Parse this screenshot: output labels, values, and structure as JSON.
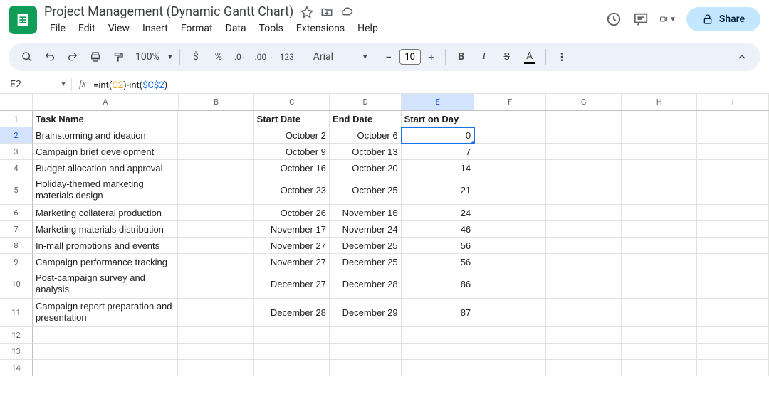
{
  "doc": {
    "title": "Project Management (Dynamic Gantt Chart)"
  },
  "menu": {
    "file": "File",
    "edit": "Edit",
    "view": "View",
    "insert": "Insert",
    "format": "Format",
    "data": "Data",
    "tools": "Tools",
    "extensions": "Extensions",
    "help": "Help"
  },
  "share": {
    "label": "Share"
  },
  "toolbar": {
    "zoom": "100%",
    "font": "Arial",
    "font_size": "10",
    "currency": "$",
    "percent": "%",
    "n123": "123"
  },
  "namebox": "E2",
  "formula": {
    "p1": "=int(",
    "ref1": "C2",
    "p2": ")-int(",
    "ref2": "$C$2",
    "p3": ")"
  },
  "columns": [
    "A",
    "B",
    "C",
    "D",
    "E",
    "F",
    "G",
    "H",
    "I"
  ],
  "headers": {
    "a": "Task Name",
    "c": "Start Date",
    "d": "End Date",
    "e": "Start on Day"
  },
  "rows": [
    {
      "n": "1"
    },
    {
      "n": "2",
      "a": "Brainstorming and ideation",
      "c": "October 2",
      "d": "October 6",
      "e": "0",
      "sel": true
    },
    {
      "n": "3",
      "a": "Campaign brief development",
      "c": "October 9",
      "d": "October 13",
      "e": "7"
    },
    {
      "n": "4",
      "a": "Budget allocation and approval",
      "c": "October 16",
      "d": "October 20",
      "e": "14"
    },
    {
      "n": "5",
      "a": "Holiday-themed marketing materials design",
      "c": "October 23",
      "d": "October 25",
      "e": "21",
      "tall": true
    },
    {
      "n": "6",
      "a": "Marketing collateral production",
      "c": "October 26",
      "d": "November 16",
      "e": "24"
    },
    {
      "n": "7",
      "a": "Marketing materials distribution",
      "c": "November 17",
      "d": "November 24",
      "e": "46"
    },
    {
      "n": "8",
      "a": "In-mall promotions and events",
      "c": "November 27",
      "d": "December 25",
      "e": "56"
    },
    {
      "n": "9",
      "a": "Campaign performance tracking",
      "c": "November 27",
      "d": "December 25",
      "e": "56"
    },
    {
      "n": "10",
      "a": "Post-campaign survey and analysis",
      "c": "December 27",
      "d": "December 28",
      "e": "86",
      "tall": true
    },
    {
      "n": "11",
      "a": "Campaign report preparation and presentation",
      "c": "December 28",
      "d": "December 29",
      "e": "87",
      "tall": true
    },
    {
      "n": "12"
    },
    {
      "n": "13"
    },
    {
      "n": "14"
    }
  ]
}
